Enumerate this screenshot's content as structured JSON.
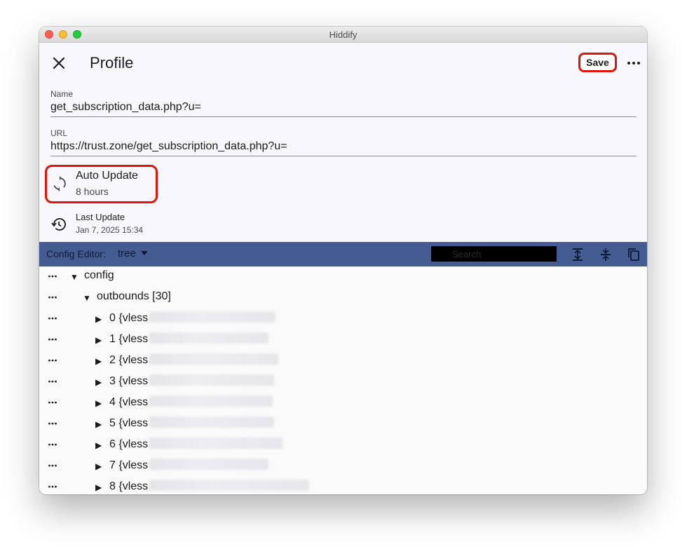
{
  "window": {
    "title": "Hiddify"
  },
  "header": {
    "title": "Profile",
    "save_label": "Save"
  },
  "fields": {
    "name": {
      "label": "Name",
      "value": "get_subscription_data.php?u="
    },
    "url": {
      "label": "URL",
      "value": "https://trust.zone/get_subscription_data.php?u="
    }
  },
  "auto_update": {
    "title": "Auto Update",
    "value": "8 hours"
  },
  "last_update": {
    "title": "Last Update",
    "value": "Jan 7, 2025 15:34"
  },
  "editor": {
    "label": "Config Editor:",
    "mode": "tree",
    "search_placeholder": "Search"
  },
  "tree": {
    "root": "config",
    "outbounds": "outbounds [30]",
    "items": [
      {
        "label": "0 {vless"
      },
      {
        "label": "1 {vless"
      },
      {
        "label": "2 {vless"
      },
      {
        "label": "3 {vless"
      },
      {
        "label": "4 {vless"
      },
      {
        "label": "5 {vless"
      },
      {
        "label": "6 {vless"
      },
      {
        "label": "7 {vless"
      },
      {
        "label": "8 {vless"
      }
    ]
  },
  "colors": {
    "editor_bar": "#445c91",
    "highlight": "#e1140a"
  }
}
